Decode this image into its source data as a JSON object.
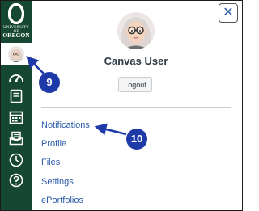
{
  "sidebar": {
    "logo": {
      "line1": "UNIVERSITY OF",
      "line2": "OREGON",
      "brand_color": "#154733"
    },
    "items": [
      {
        "name": "account",
        "icon": "avatar-icon"
      },
      {
        "name": "dashboard",
        "icon": "dashboard-icon"
      },
      {
        "name": "courses",
        "icon": "courses-icon"
      },
      {
        "name": "calendar",
        "icon": "calendar-icon"
      },
      {
        "name": "inbox",
        "icon": "inbox-icon"
      },
      {
        "name": "history",
        "icon": "clock-icon"
      },
      {
        "name": "help",
        "icon": "help-icon"
      }
    ]
  },
  "tray": {
    "close_label": "✕",
    "user_name": "Canvas User",
    "logout_label": "Logout",
    "links": [
      "Notifications",
      "Profile",
      "Files",
      "Settings",
      "ePortfolios"
    ]
  },
  "callouts": {
    "first": "9",
    "second": "10",
    "color": "#1e3aa8"
  }
}
